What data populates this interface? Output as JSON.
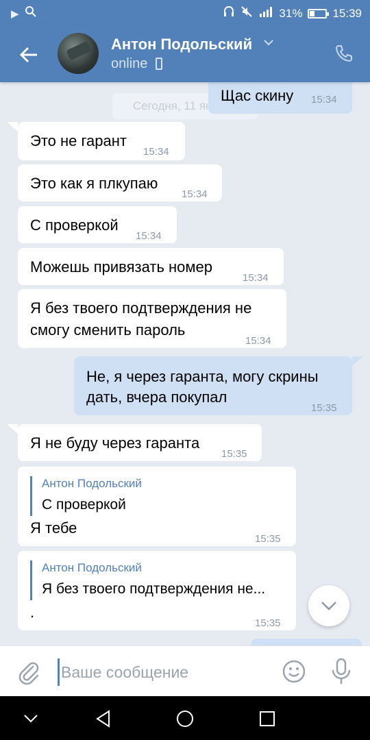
{
  "status_bar": {
    "battery_percent": "31%",
    "battery_level": 0.31,
    "time": "15:39"
  },
  "header": {
    "contact_name": "Антон Подольский",
    "status": "online",
    "accent": "#5181b8"
  },
  "chat": {
    "date_separator": "Сегодня, 11 января",
    "messages": [
      {
        "direction": "out",
        "text": "Щас скину",
        "time": "15:34"
      },
      {
        "direction": "in",
        "text": "Это не гарант",
        "time": "15:34"
      },
      {
        "direction": "in",
        "text": "Это как я плкупаю",
        "time": "15:34"
      },
      {
        "direction": "in",
        "text": "С проверкой",
        "time": "15:34"
      },
      {
        "direction": "in",
        "text": "Можешь привязать номер",
        "time": "15:34"
      },
      {
        "direction": "in",
        "text_line1": "Я без твоего подтверждения не",
        "text_line2": "смогу сменить пароль",
        "time": "15:34"
      },
      {
        "direction": "out",
        "text_line1": "Не, я через гаранта, могу скрины",
        "text_line2": "дать, вчера покупал",
        "time": "15:35"
      },
      {
        "direction": "in",
        "text": "Я не буду через гаранта",
        "time": "15:35"
      },
      {
        "direction": "in",
        "reply_name": "Антон Подольский",
        "reply_text": "С проверкой",
        "text": "Я тебе",
        "time": "15:35"
      },
      {
        "direction": "in",
        "reply_name": "Антон Подольский",
        "reply_text": "Я без твоего подтверждения не...",
        "text": ".",
        "time": "15:35"
      }
    ]
  },
  "composer": {
    "placeholder": "Ваше сообщение"
  },
  "icons": {
    "back": "arrow-left-icon",
    "call": "phone-icon",
    "attach": "paperclip-icon",
    "emoji": "smiley-icon",
    "mic": "microphone-icon",
    "scroll": "chevron-down-icon"
  }
}
